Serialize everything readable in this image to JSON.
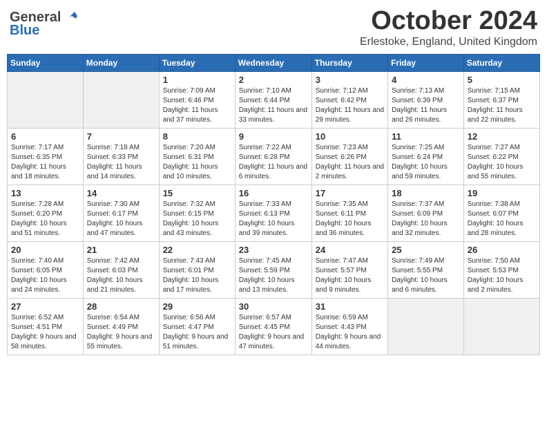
{
  "header": {
    "logo_general": "General",
    "logo_blue": "Blue",
    "month_title": "October 2024",
    "location": "Erlestoke, England, United Kingdom"
  },
  "days_of_week": [
    "Sunday",
    "Monday",
    "Tuesday",
    "Wednesday",
    "Thursday",
    "Friday",
    "Saturday"
  ],
  "weeks": [
    [
      {
        "day": "",
        "info": ""
      },
      {
        "day": "",
        "info": ""
      },
      {
        "day": "1",
        "info": "Sunrise: 7:09 AM\nSunset: 6:46 PM\nDaylight: 11 hours and 37 minutes."
      },
      {
        "day": "2",
        "info": "Sunrise: 7:10 AM\nSunset: 6:44 PM\nDaylight: 11 hours and 33 minutes."
      },
      {
        "day": "3",
        "info": "Sunrise: 7:12 AM\nSunset: 6:42 PM\nDaylight: 11 hours and 29 minutes."
      },
      {
        "day": "4",
        "info": "Sunrise: 7:13 AM\nSunset: 6:39 PM\nDaylight: 11 hours and 26 minutes."
      },
      {
        "day": "5",
        "info": "Sunrise: 7:15 AM\nSunset: 6:37 PM\nDaylight: 11 hours and 22 minutes."
      }
    ],
    [
      {
        "day": "6",
        "info": "Sunrise: 7:17 AM\nSunset: 6:35 PM\nDaylight: 11 hours and 18 minutes."
      },
      {
        "day": "7",
        "info": "Sunrise: 7:18 AM\nSunset: 6:33 PM\nDaylight: 11 hours and 14 minutes."
      },
      {
        "day": "8",
        "info": "Sunrise: 7:20 AM\nSunset: 6:31 PM\nDaylight: 11 hours and 10 minutes."
      },
      {
        "day": "9",
        "info": "Sunrise: 7:22 AM\nSunset: 6:28 PM\nDaylight: 11 hours and 6 minutes."
      },
      {
        "day": "10",
        "info": "Sunrise: 7:23 AM\nSunset: 6:26 PM\nDaylight: 11 hours and 2 minutes."
      },
      {
        "day": "11",
        "info": "Sunrise: 7:25 AM\nSunset: 6:24 PM\nDaylight: 10 hours and 59 minutes."
      },
      {
        "day": "12",
        "info": "Sunrise: 7:27 AM\nSunset: 6:22 PM\nDaylight: 10 hours and 55 minutes."
      }
    ],
    [
      {
        "day": "13",
        "info": "Sunrise: 7:28 AM\nSunset: 6:20 PM\nDaylight: 10 hours and 51 minutes."
      },
      {
        "day": "14",
        "info": "Sunrise: 7:30 AM\nSunset: 6:17 PM\nDaylight: 10 hours and 47 minutes."
      },
      {
        "day": "15",
        "info": "Sunrise: 7:32 AM\nSunset: 6:15 PM\nDaylight: 10 hours and 43 minutes."
      },
      {
        "day": "16",
        "info": "Sunrise: 7:33 AM\nSunset: 6:13 PM\nDaylight: 10 hours and 39 minutes."
      },
      {
        "day": "17",
        "info": "Sunrise: 7:35 AM\nSunset: 6:11 PM\nDaylight: 10 hours and 36 minutes."
      },
      {
        "day": "18",
        "info": "Sunrise: 7:37 AM\nSunset: 6:09 PM\nDaylight: 10 hours and 32 minutes."
      },
      {
        "day": "19",
        "info": "Sunrise: 7:38 AM\nSunset: 6:07 PM\nDaylight: 10 hours and 28 minutes."
      }
    ],
    [
      {
        "day": "20",
        "info": "Sunrise: 7:40 AM\nSunset: 6:05 PM\nDaylight: 10 hours and 24 minutes."
      },
      {
        "day": "21",
        "info": "Sunrise: 7:42 AM\nSunset: 6:03 PM\nDaylight: 10 hours and 21 minutes."
      },
      {
        "day": "22",
        "info": "Sunrise: 7:43 AM\nSunset: 6:01 PM\nDaylight: 10 hours and 17 minutes."
      },
      {
        "day": "23",
        "info": "Sunrise: 7:45 AM\nSunset: 5:59 PM\nDaylight: 10 hours and 13 minutes."
      },
      {
        "day": "24",
        "info": "Sunrise: 7:47 AM\nSunset: 5:57 PM\nDaylight: 10 hours and 9 minutes."
      },
      {
        "day": "25",
        "info": "Sunrise: 7:49 AM\nSunset: 5:55 PM\nDaylight: 10 hours and 6 minutes."
      },
      {
        "day": "26",
        "info": "Sunrise: 7:50 AM\nSunset: 5:53 PM\nDaylight: 10 hours and 2 minutes."
      }
    ],
    [
      {
        "day": "27",
        "info": "Sunrise: 6:52 AM\nSunset: 4:51 PM\nDaylight: 9 hours and 58 minutes."
      },
      {
        "day": "28",
        "info": "Sunrise: 6:54 AM\nSunset: 4:49 PM\nDaylight: 9 hours and 55 minutes."
      },
      {
        "day": "29",
        "info": "Sunrise: 6:56 AM\nSunset: 4:47 PM\nDaylight: 9 hours and 51 minutes."
      },
      {
        "day": "30",
        "info": "Sunrise: 6:57 AM\nSunset: 4:45 PM\nDaylight: 9 hours and 47 minutes."
      },
      {
        "day": "31",
        "info": "Sunrise: 6:59 AM\nSunset: 4:43 PM\nDaylight: 9 hours and 44 minutes."
      },
      {
        "day": "",
        "info": ""
      },
      {
        "day": "",
        "info": ""
      }
    ]
  ]
}
